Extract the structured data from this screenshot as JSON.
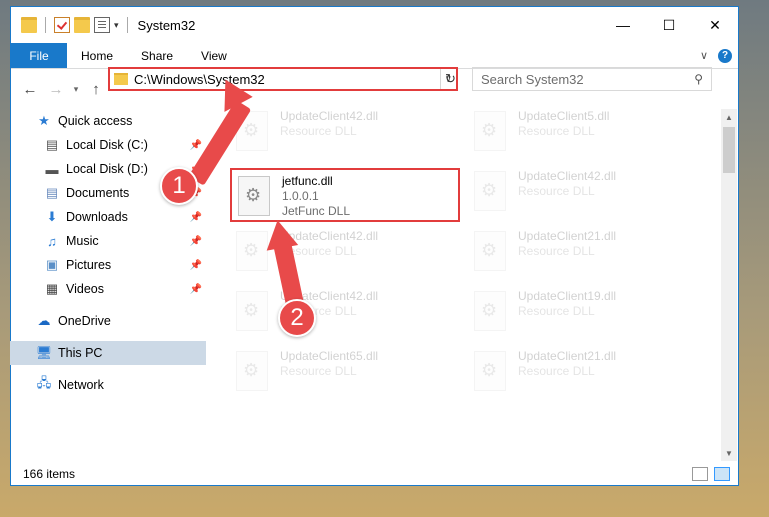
{
  "window": {
    "title": "System32"
  },
  "ribbon": {
    "tabs": [
      "File",
      "Home",
      "Share",
      "View"
    ]
  },
  "address": {
    "path": "C:\\Windows\\System32"
  },
  "search": {
    "placeholder": "Search System32"
  },
  "nav": {
    "items": [
      {
        "label": "Quick access",
        "icon": "star-icon",
        "pinned": false
      },
      {
        "label": "Local Disk (C:)",
        "icon": "drive-icon",
        "pinned": true
      },
      {
        "label": "Local Disk (D:)",
        "icon": "drive-icon",
        "pinned": true
      },
      {
        "label": "Documents",
        "icon": "documents-icon",
        "pinned": true
      },
      {
        "label": "Downloads",
        "icon": "download-icon",
        "pinned": true
      },
      {
        "label": "Music",
        "icon": "music-icon",
        "pinned": true
      },
      {
        "label": "Pictures",
        "icon": "pictures-icon",
        "pinned": true
      },
      {
        "label": "Videos",
        "icon": "videos-icon",
        "pinned": true
      },
      {
        "label": "OneDrive",
        "icon": "cloud-icon",
        "pinned": false
      },
      {
        "label": "This PC",
        "icon": "computer-icon",
        "pinned": false
      },
      {
        "label": "Network",
        "icon": "network-icon",
        "pinned": false
      }
    ]
  },
  "files": {
    "highlighted": {
      "name": "jetfunc.dll",
      "version": "1.0.0.1",
      "description": "JetFunc DLL"
    },
    "faded": [
      {
        "name": "UpdateClient42.dll",
        "type": "Resource DLL"
      },
      {
        "name": "UpdateClient5.dll",
        "type": "Resource DLL"
      },
      {
        "name": "UpdateClient42.dll",
        "type": "Resource DLL"
      },
      {
        "name": "UpdateClient42.dll",
        "type": "Resource DLL"
      },
      {
        "name": "UpdateClient21.dll",
        "type": "Resource DLL"
      },
      {
        "name": "UpdateClient42.dll",
        "type": "Resource DLL"
      },
      {
        "name": "UpdateClient19.dll",
        "type": "Resource DLL"
      },
      {
        "name": "UpdateClient65.dll",
        "type": "Resource DLL"
      },
      {
        "name": "UpdateClient21.dll",
        "type": "Resource DLL"
      }
    ]
  },
  "status": {
    "item_count": "166 items"
  },
  "annotations": {
    "step1": "1",
    "step2": "2"
  },
  "colors": {
    "accent": "#1979ca",
    "highlight": "#e23c3c",
    "annotation": "#e84a4a"
  }
}
